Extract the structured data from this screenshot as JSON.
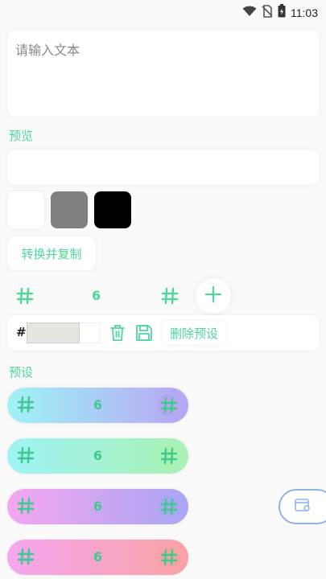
{
  "status_bar": {
    "time": "11:03",
    "icons": [
      "wifi-icon",
      "no-sim-icon",
      "battery-icon"
    ]
  },
  "text_input": {
    "placeholder": "请输入文本"
  },
  "preview": {
    "label": "预览"
  },
  "swatches": [
    {
      "name": "white",
      "color": "#ffffff"
    },
    {
      "name": "gray",
      "color": "#808080"
    },
    {
      "name": "black",
      "color": "#000000"
    }
  ],
  "convert_button": {
    "label": "转换并复制"
  },
  "count_row": {
    "count": "6",
    "icons": [
      "hash-icon",
      "hash-icon",
      "plus-icon"
    ]
  },
  "color_row": {
    "hash": "#",
    "hex_value": "",
    "delete_preset_label": "删除预设",
    "icons": [
      "trash-icon",
      "save-icon"
    ]
  },
  "presets": {
    "label": "预设",
    "items": [
      {
        "count": "6",
        "gradient": [
          "#9ff3f6",
          "#b7a6f4"
        ]
      },
      {
        "count": "6",
        "gradient": [
          "#9ff3f6",
          "#a9f1b3"
        ]
      },
      {
        "count": "6",
        "gradient": [
          "#f5a6f0",
          "#a9a6f4"
        ]
      },
      {
        "count": "6",
        "gradient": [
          "#f5a6f0",
          "#f8a3a3"
        ]
      }
    ]
  },
  "accent_color": "#4fd69c",
  "floating_button": {
    "icon": "wallet-icon"
  }
}
